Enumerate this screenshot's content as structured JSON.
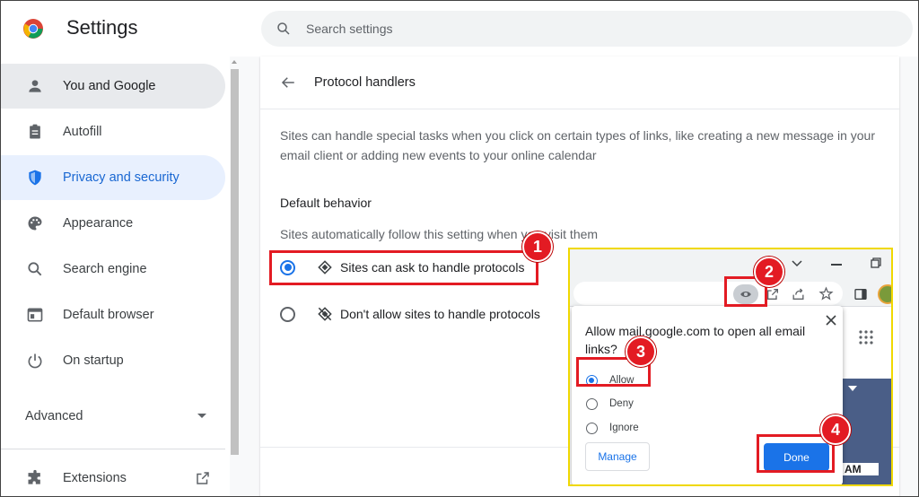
{
  "header": {
    "title": "Settings",
    "search_placeholder": "Search settings",
    "logo_icon": "chrome-logo-icon",
    "search_icon": "search-icon"
  },
  "sidebar": {
    "items": [
      {
        "label": "You and Google",
        "icon": "person-icon",
        "state": "hover"
      },
      {
        "label": "Autofill",
        "icon": "clipboard-icon",
        "state": "normal"
      },
      {
        "label": "Privacy and security",
        "icon": "shield-icon",
        "state": "selected"
      },
      {
        "label": "Appearance",
        "icon": "palette-icon",
        "state": "normal"
      },
      {
        "label": "Search engine",
        "icon": "search-icon",
        "state": "normal"
      },
      {
        "label": "Default browser",
        "icon": "browser-window-icon",
        "state": "normal"
      },
      {
        "label": "On startup",
        "icon": "power-icon",
        "state": "normal"
      }
    ],
    "advanced_label": "Advanced",
    "extensions_label": "Extensions"
  },
  "main": {
    "page_title": "Protocol handlers",
    "description": "Sites can handle special tasks when you click on certain types of links, like creating a new message in your email client or adding new events to your online calendar",
    "default_behavior_title": "Default behavior",
    "default_behavior_sub": "Sites automatically follow this setting when you visit them",
    "options": [
      {
        "label": "Sites can ask to handle protocols",
        "selected": true,
        "icon": "protocol-handler-icon"
      },
      {
        "label": "Don't allow sites to handle protocols",
        "selected": false,
        "icon": "protocol-handler-off-icon"
      }
    ]
  },
  "inset": {
    "popup_question": "Allow mail.google.com to open all email links?",
    "options": [
      {
        "label": "Allow",
        "selected": true
      },
      {
        "label": "Deny",
        "selected": false
      },
      {
        "label": "Ignore",
        "selected": false
      }
    ],
    "manage_label": "Manage",
    "done_label": "Done",
    "time_fragment": "AM"
  },
  "callouts": [
    "1",
    "2",
    "3",
    "4"
  ],
  "colors": {
    "accent": "#1a73e8",
    "callout_red": "#e31b23",
    "inset_border": "#f0d800",
    "selected_bg": "#e8f0fe",
    "hover_bg": "#e8eaed"
  }
}
